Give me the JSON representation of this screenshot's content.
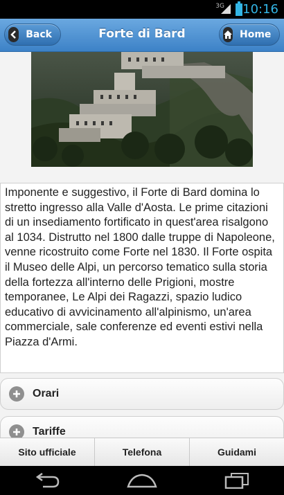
{
  "status_bar": {
    "network": "3G",
    "time": "10:16",
    "battery_icon": "battery-icon",
    "signal_icon": "signal-icon"
  },
  "header": {
    "title": "Forte di Bard",
    "back_label": "Back",
    "home_label": "Home",
    "back_icon": "chevron-left-icon",
    "home_icon": "home-icon"
  },
  "description": "Imponente e suggestivo, il Forte di Bard domina lo stretto ingresso alla Valle d'Aosta. Le prime citazioni di un insediamento fortificato in quest'area risalgono al 1034. Distrutto nel 1800 dalle truppe di Napoleone, venne ricostruito come Forte nel 1830. Il Forte ospita il Museo delle Alpi, un percorso tematico sulla storia della fortezza all'interno delle Prigioni, mostre temporanee, Le Alpi dei Ragazzi, spazio ludico educativo di avvicinamento all'alpinismo, un'area commerciale, sale conferenze ed eventi estivi nella Piazza d'Armi.",
  "sections": [
    {
      "label": "Orari",
      "icon": "plus-icon"
    },
    {
      "label": "Tariffe",
      "icon": "plus-icon"
    }
  ],
  "tabs": [
    {
      "label": "Sito ufficiale"
    },
    {
      "label": "Telefona"
    },
    {
      "label": "Guidami"
    }
  ],
  "nav": {
    "back_icon": "back-nav-icon",
    "home_icon": "home-nav-icon",
    "recents_icon": "recent-apps-icon"
  },
  "colors": {
    "header": "#3d82c7",
    "accent": "#33b5e5"
  }
}
